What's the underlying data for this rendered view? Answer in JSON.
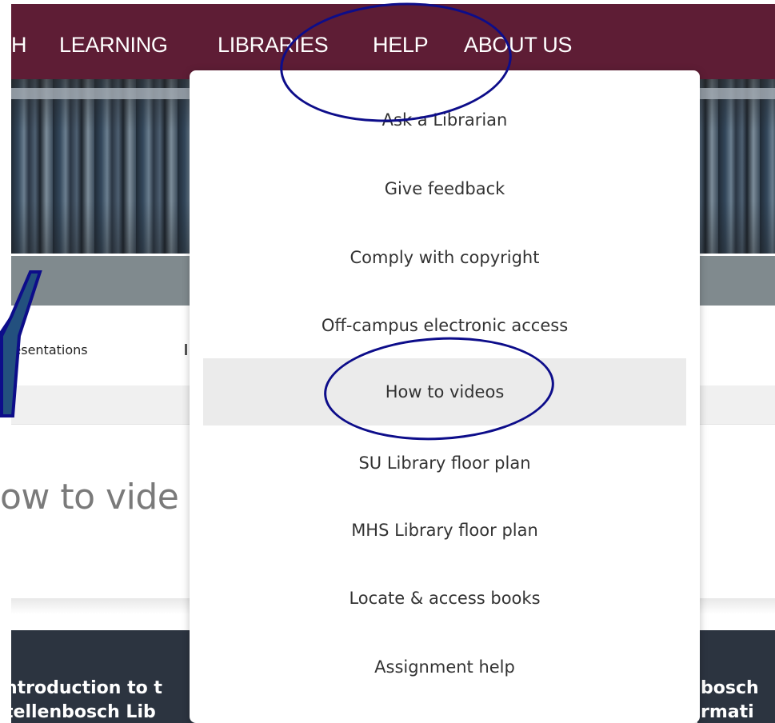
{
  "nav": {
    "items": [
      {
        "label": "H"
      },
      {
        "label": "LEARNING"
      },
      {
        "label": "LIBRARIES"
      },
      {
        "label": "HELP"
      },
      {
        "label": "ABOUT US"
      }
    ]
  },
  "breadcrumb": {
    "text": "presentations"
  },
  "page_heading": "ow to vide",
  "dropdown": {
    "items": [
      {
        "label": "Ask a Librarian"
      },
      {
        "label": "Give feedback"
      },
      {
        "label": "Comply with copyright"
      },
      {
        "label": "Off-campus electronic access"
      },
      {
        "label": "How to videos"
      },
      {
        "label": "SU Library floor plan"
      },
      {
        "label": "MHS Library floor plan"
      },
      {
        "label": "Locate & access books"
      },
      {
        "label": "Assignment help"
      }
    ],
    "active_label": "How to videos"
  },
  "thumbnails": {
    "left_line1": "ntroduction to t",
    "left_line2": "tellenbosch Lib",
    "right_line1": "bosch",
    "right_line2": "rmati"
  },
  "colors": {
    "navbar": "#5e1d35",
    "annotation": "#0d0d8a",
    "arrow_fill": "#23507e"
  }
}
